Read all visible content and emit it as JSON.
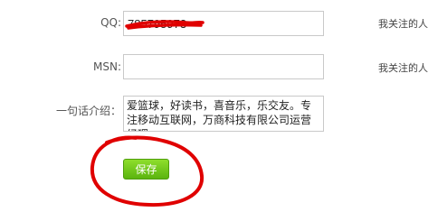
{
  "form": {
    "qq": {
      "label": "QQ:",
      "value": "785795973",
      "hint": "我关注的人"
    },
    "msn": {
      "label": "MSN:",
      "value": "",
      "hint": "我关注的人"
    },
    "intro": {
      "label": "一句话介绍：",
      "value": "爱篮球，好读书，喜音乐，乐交友。专注移动互联网，万商科技有限公司运营经理。"
    },
    "save_label": "保存"
  },
  "annotation": {
    "color": "#e00000"
  }
}
